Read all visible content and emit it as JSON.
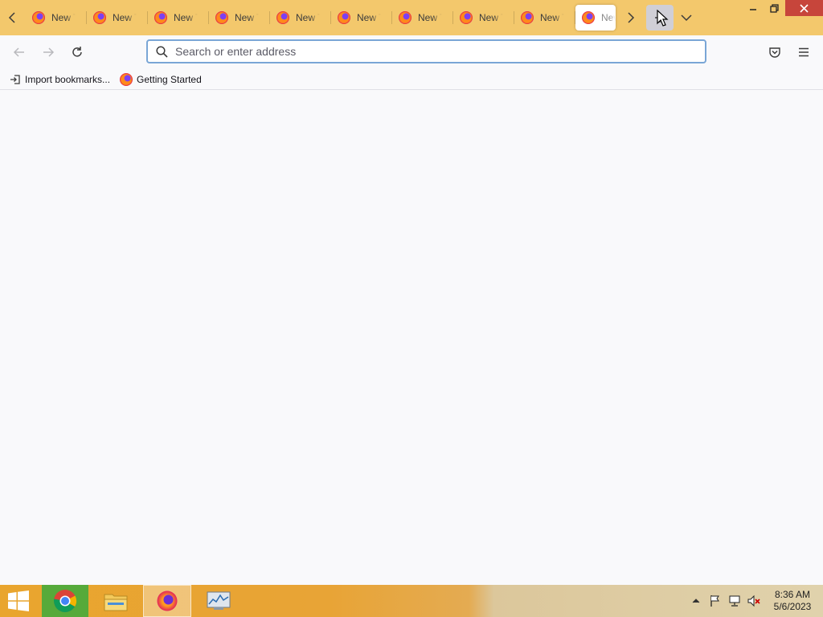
{
  "browser": {
    "tabs": [
      {
        "label": "New Tab",
        "active": false
      },
      {
        "label": "New Tab",
        "active": false
      },
      {
        "label": "New Tab",
        "active": false
      },
      {
        "label": "New Tab",
        "active": false
      },
      {
        "label": "New Tab",
        "active": false
      },
      {
        "label": "New Tab",
        "active": false
      },
      {
        "label": "New Tab",
        "active": false
      },
      {
        "label": "New Tab",
        "active": false
      },
      {
        "label": "New Tab",
        "active": false
      },
      {
        "label": "New Tab",
        "active": true
      }
    ],
    "tab_icon": "firefox-icon",
    "urlbar": {
      "value": "",
      "placeholder": "Search or enter address"
    },
    "bookmarks": [
      {
        "label": "Import bookmarks...",
        "icon": "import-icon"
      },
      {
        "label": "Getting Started",
        "icon": "firefox-icon"
      }
    ],
    "colors": {
      "tabstrip": "#f3c86c",
      "toolbar": "#f9f9fb",
      "urlbar_focus_border": "#7aa6d6",
      "close_button": "#c7453b"
    }
  },
  "taskbar": {
    "apps": [
      {
        "name": "Google Chrome",
        "icon": "chrome-icon"
      },
      {
        "name": "File Explorer",
        "icon": "folder-icon"
      },
      {
        "name": "Firefox",
        "icon": "firefox-icon"
      },
      {
        "name": "Resource Monitor",
        "icon": "monitor-icon"
      }
    ],
    "clock": {
      "time": "8:36 AM",
      "date": "5/6/2023"
    }
  }
}
